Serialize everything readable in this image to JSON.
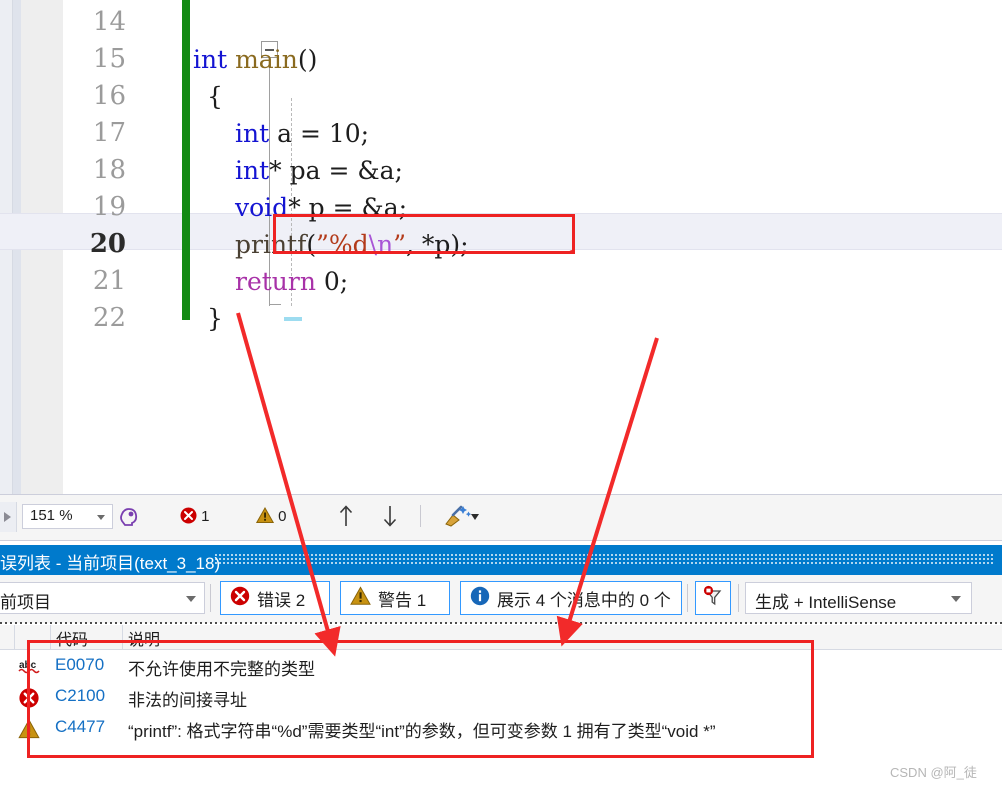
{
  "editor": {
    "zoom_level": "151 %",
    "lines": [
      {
        "number": "14",
        "current": false,
        "tokens": []
      },
      {
        "number": "15",
        "current": false,
        "tokens": [
          {
            "t": "int ",
            "c": "kw"
          },
          {
            "t": "main",
            "c": "fn"
          },
          {
            "t": "()",
            "c": "num"
          }
        ]
      },
      {
        "number": "16",
        "current": false,
        "tokens": [
          {
            "t": "{",
            "c": "num"
          }
        ]
      },
      {
        "number": "17",
        "current": false,
        "tokens": [
          {
            "t": "int",
            "c": "kw"
          },
          {
            "t": " a = ",
            "c": "num"
          },
          {
            "t": "10;",
            "c": "num"
          }
        ]
      },
      {
        "number": "18",
        "current": false,
        "tokens": [
          {
            "t": "int",
            "c": "kw"
          },
          {
            "t": "* pa = &a;",
            "c": "num"
          }
        ]
      },
      {
        "number": "19",
        "current": false,
        "tokens": [
          {
            "t": "void",
            "c": "kw"
          },
          {
            "t": "* p = &a;",
            "c": "num"
          }
        ]
      },
      {
        "number": "20",
        "current": true,
        "tokens": [
          {
            "t": "printf",
            "c": "pf"
          },
          {
            "t": "(",
            "c": "num"
          },
          {
            "t": "”%d",
            "c": "str"
          },
          {
            "t": "\\n",
            "c": "esc"
          },
          {
            "t": "”",
            "c": "str"
          },
          {
            "t": ", *p);",
            "c": "num"
          }
        ]
      },
      {
        "number": "21",
        "current": false,
        "tokens": [
          {
            "t": "return",
            "c": "ret"
          },
          {
            "t": " 0;",
            "c": "num"
          }
        ]
      },
      {
        "number": "22",
        "current": false,
        "tokens": [
          {
            "t": "}",
            "c": "num"
          }
        ]
      }
    ]
  },
  "statusbar": {
    "error_count": "1",
    "warning_count": "0",
    "prev_label": "↑",
    "next_label": "↓"
  },
  "error_list": {
    "panel_title": "误列表 - 当前项目(text_3_18)",
    "scope_filter": "前项目",
    "buttons": {
      "errors": "错误 2",
      "warnings": "警告 1",
      "messages": "展示 4 个消息中的 0 个"
    },
    "build_filter": "生成 + IntelliSense",
    "columns": [
      "代码",
      "说明"
    ],
    "rows": [
      {
        "severity": "intellisense",
        "code": "E0070",
        "description": "不允许使用不完整的类型"
      },
      {
        "severity": "error",
        "code": "C2100",
        "description": "非法的间接寻址"
      },
      {
        "severity": "warning",
        "code": "C4477",
        "description": "“printf”: 格式字符串“%d”需要类型“int”的参数，但可变参数 1 拥有了类型“void *”"
      }
    ]
  },
  "watermark": "CSDN @阿_徒",
  "colors": {
    "accent_blue": "#007acc",
    "annotation_red": "#ee2222",
    "error_red": "#cc0000",
    "warning_amber": "#b8860b",
    "code_link_blue": "#1570c4",
    "change_bar_green": "#138a13"
  }
}
